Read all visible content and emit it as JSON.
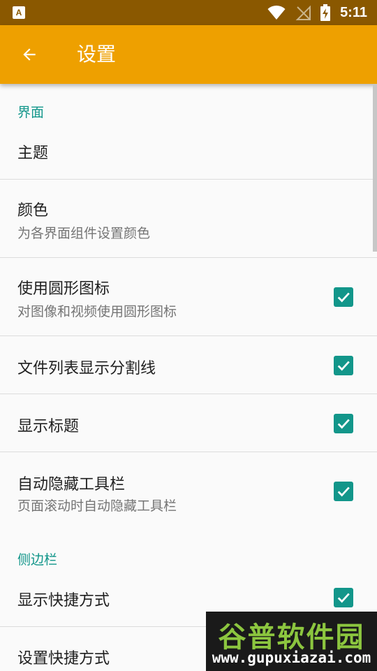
{
  "status_bar": {
    "time": "5:11",
    "icons": [
      "app-notification-icon",
      "wifi-icon",
      "no-signal-icon",
      "battery-charging-icon"
    ]
  },
  "app_bar": {
    "title": "设置",
    "back_icon": "arrow-left-icon"
  },
  "sections": [
    {
      "header": "界面",
      "items": [
        {
          "title": "主题"
        },
        {
          "title": "颜色",
          "summary": "为各界面组件设置颜色"
        },
        {
          "title": "使用圆形图标",
          "summary": "对图像和视频使用圆形图标",
          "checked": true
        },
        {
          "title": "文件列表显示分割线",
          "checked": true
        },
        {
          "title": "显示标题",
          "checked": true
        },
        {
          "title": "自动隐藏工具栏",
          "summary": "页面滚动时自动隐藏工具栏",
          "checked": true
        }
      ]
    },
    {
      "header": "侧边栏",
      "items": [
        {
          "title": "显示快捷方式",
          "checked": true
        },
        {
          "title": "设置快捷方式"
        }
      ]
    }
  ],
  "watermark": {
    "name": "谷普软件园",
    "url": "www.gupuxiazai.com"
  },
  "colors": {
    "status_bar": "#8a5800",
    "app_bar": "#eea000",
    "accent": "#12968a",
    "background": "#fafafa"
  }
}
